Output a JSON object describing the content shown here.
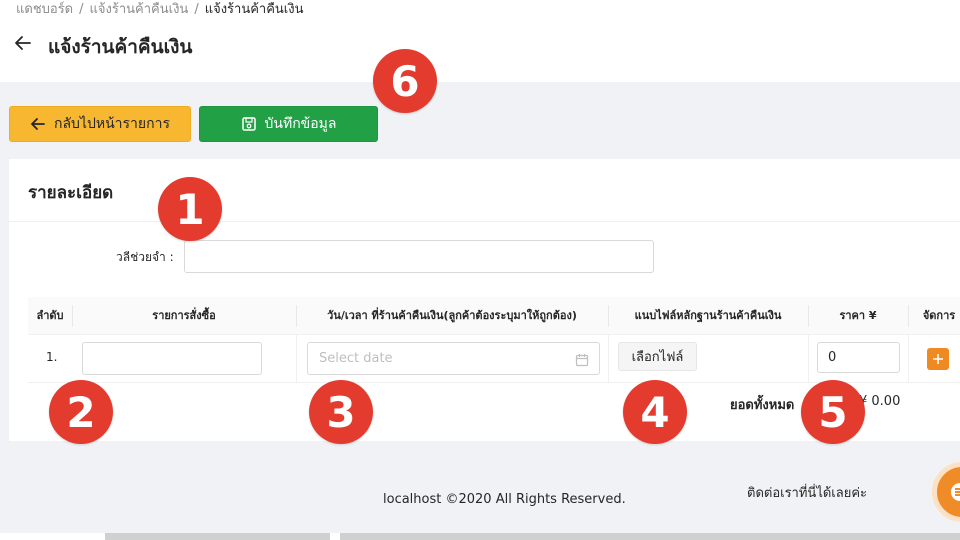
{
  "breadcrumb": {
    "items": [
      "แดชบอร์ด",
      "แจ้งร้านค้าคืนเงิน"
    ],
    "current": "แจ้งร้านค้าคืนเงิน",
    "separator": "/"
  },
  "page_title": "แจ้งร้านค้าคืนเงิน",
  "toolbar": {
    "back_label": "กลับไปหน้ารายการ",
    "save_label": "บันทึกข้อมูล"
  },
  "card": {
    "title": "รายละเอียด",
    "memo_label": "วลีช่วยจำ :",
    "memo_value": ""
  },
  "table": {
    "headers": [
      "ลำดับ",
      "รายการสั่งซื้อ",
      "วัน/เวลา ที่ร้านค้าคืนเงิน(ลูกค้าต้องระบุมาให้ถูกต้อง)",
      "แนบไฟล์หลักฐานร้านค้าคืนเงิน",
      "ราคา ¥",
      "จัดการ"
    ],
    "rows": [
      {
        "index": "1.",
        "order_value": "",
        "date_placeholder": "Select date",
        "file_button": "เลือกไฟล์",
        "price": "0"
      }
    ],
    "total_label": "ยอดทั้งหมด",
    "total_value": "¥ 0.00"
  },
  "footer": {
    "copyright": "localhost ©2020 All Rights Reserved.",
    "contact": "ติดต่อเราที่นี่ได้เลยค่ะ"
  },
  "markers": [
    "1",
    "2",
    "3",
    "4",
    "5",
    "6"
  ],
  "colors": {
    "back_button": "#f7b731",
    "save_button": "#22a045",
    "add_button": "#ef8a23",
    "marker": "#e33b2e",
    "chat_bubble": "#f08c28"
  },
  "icons": [
    "back-arrow-icon",
    "arrow-left-icon",
    "save-icon",
    "calendar-icon",
    "plus-icon",
    "chat-icon"
  ]
}
